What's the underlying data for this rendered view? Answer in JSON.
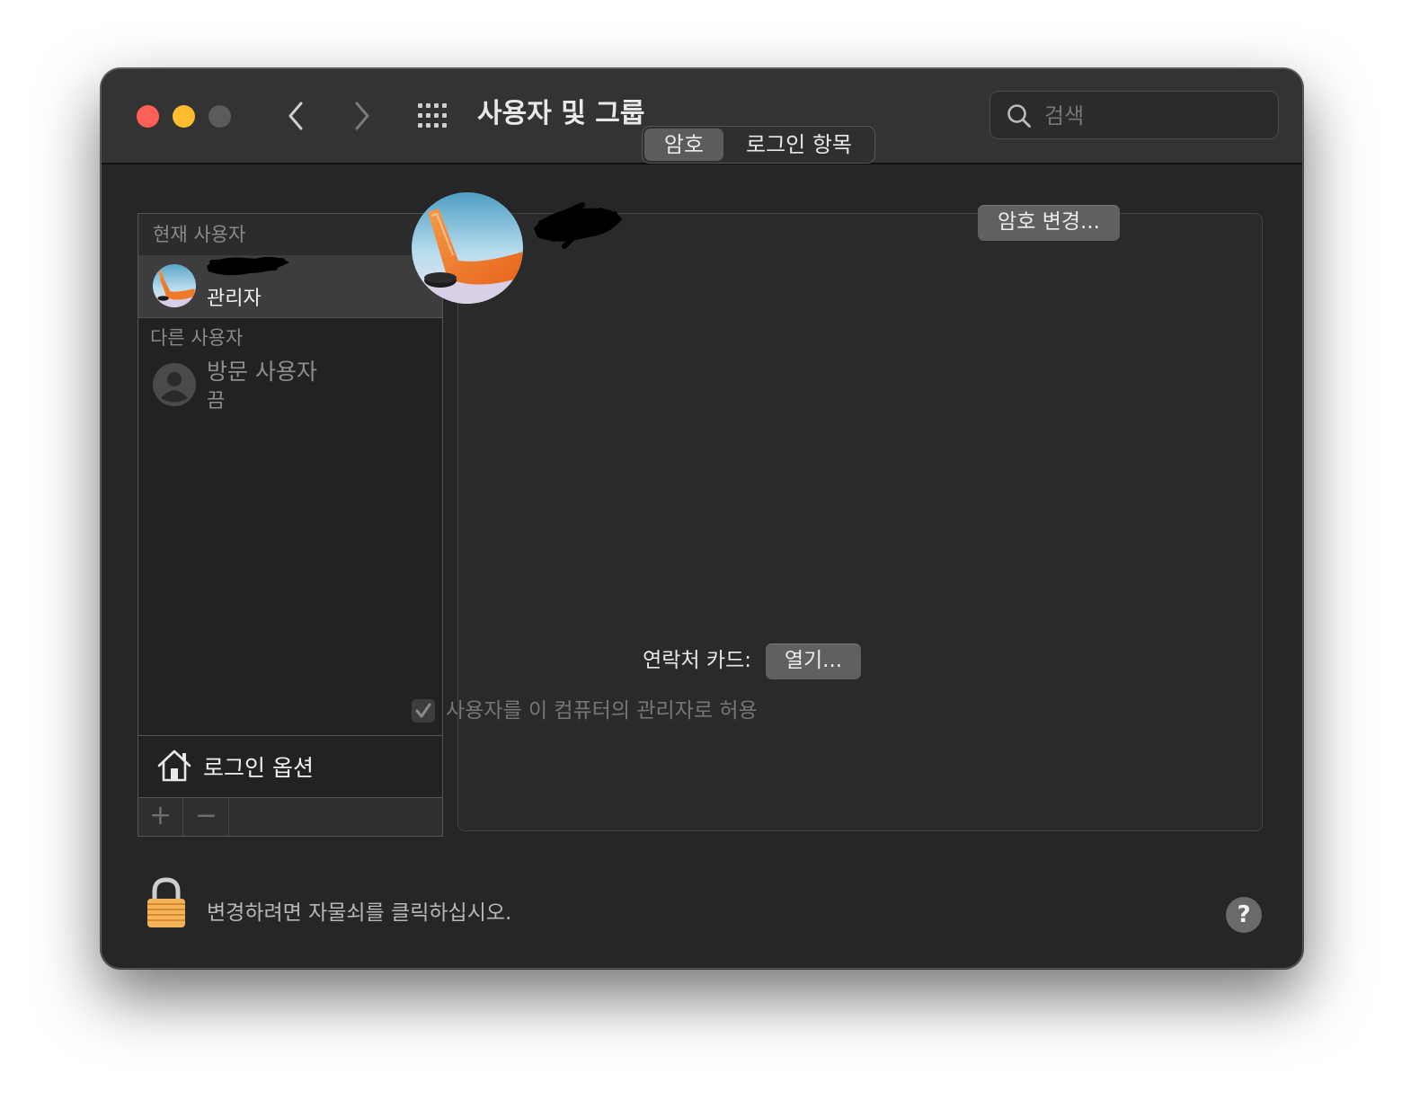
{
  "window": {
    "title": "사용자 및 그룹"
  },
  "search": {
    "placeholder": "검색",
    "value": ""
  },
  "sidebar": {
    "current_header": "현재 사용자",
    "current_user": {
      "name_redacted": true,
      "role": "관리자"
    },
    "other_header": "다른 사용자",
    "guest": {
      "name": "방문 사용자",
      "status": "끔"
    },
    "login_options_label": "로그인 옵션",
    "add_label": "+",
    "remove_label": "−"
  },
  "tabs": [
    {
      "label": "암호",
      "selected": true
    },
    {
      "label": "로그인 항목",
      "selected": false
    }
  ],
  "main": {
    "change_password_label": "암호 변경...",
    "contact_card_label": "연락처 카드:",
    "open_label": "열기...",
    "admin_checkbox_label": "사용자를 이 컴퓨터의 관리자로 허용",
    "admin_checked": true
  },
  "footer": {
    "lock_label": "변경하려면 자물쇠를 클릭하십시오.",
    "help_label": "?"
  },
  "colors": {
    "close": "#fe5f57",
    "minimize": "#febc2e",
    "zoom_disabled": "#5b5b5b",
    "selected_row": "#3d3d3d",
    "lock": "#f2b35a"
  },
  "icons": [
    "back-chevron-icon",
    "forward-chevron-icon",
    "grid-icon",
    "search-icon",
    "house-icon",
    "lock-icon",
    "guest-person-icon",
    "checkmark-icon"
  ]
}
